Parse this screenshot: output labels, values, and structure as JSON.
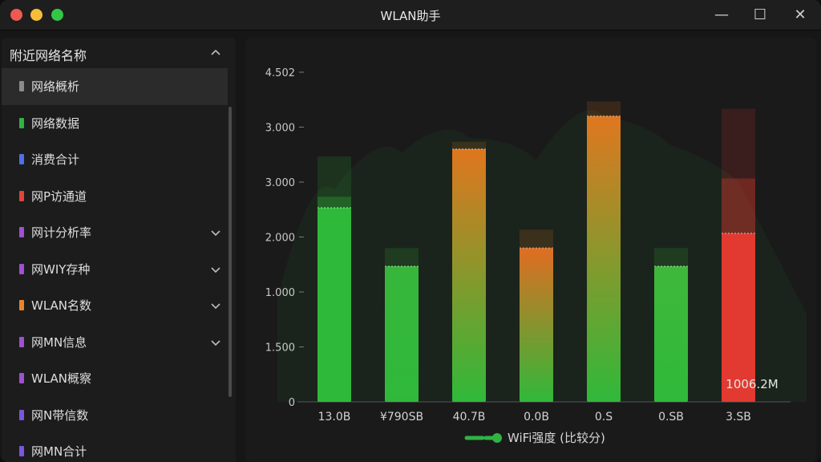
{
  "window": {
    "title": "WLAN助手",
    "controls": {
      "minimize": "—",
      "maximize": "☐",
      "close": "✕"
    }
  },
  "sidebar": {
    "header": "附近网络名称",
    "items": [
      {
        "label": "网络概析",
        "color": "#8a8a8a",
        "active": true,
        "expandable": false
      },
      {
        "label": "网络数据",
        "color": "#2fb344",
        "active": false,
        "expandable": false
      },
      {
        "label": "消费合计",
        "color": "#4f6ee8",
        "active": false,
        "expandable": false
      },
      {
        "label": "网P访通道",
        "color": "#e0443a",
        "active": false,
        "expandable": false
      },
      {
        "label": "网计分析率",
        "color": "#a050d0",
        "active": false,
        "expandable": true
      },
      {
        "label": "网WIY存种",
        "color": "#a050d0",
        "active": false,
        "expandable": true
      },
      {
        "label": "WLAN名数",
        "color": "#e8842e",
        "active": false,
        "expandable": true
      },
      {
        "label": "网MN信息",
        "color": "#a050d0",
        "active": false,
        "expandable": true
      },
      {
        "label": "WLAN概察",
        "color": "#a050d0",
        "active": false,
        "expandable": false
      },
      {
        "label": "网N带信数",
        "color": "#7a55e0",
        "active": false,
        "expandable": false
      },
      {
        "label": "网MN合计",
        "color": "#7a55e0",
        "active": false,
        "expandable": false
      }
    ]
  },
  "chart_data": {
    "type": "bar",
    "y_tick_labels": [
      "0",
      "1.500",
      "1.000",
      "2.000",
      "3.000",
      "3.000",
      "4.502"
    ],
    "categories": [
      "13.0B",
      "¥790SB",
      "40.7B",
      "0.0B",
      "0.S",
      "0.SB",
      "3.SB"
    ],
    "series": [
      {
        "name": "WiFi强度 (比较分)",
        "values": [
          2.65,
          1.85,
          3.45,
          2.1,
          3.9,
          1.85,
          2.3
        ],
        "ghost_values": [
          3.35,
          2.1,
          3.55,
          2.35,
          4.1,
          2.1,
          4.0
        ],
        "mid_values": [
          2.8,
          0,
          0,
          0,
          0,
          0,
          3.05
        ],
        "colors": [
          "#2fb93a",
          "#37b63a",
          "#e0761e",
          "#e06d22",
          "#e07720",
          "#3fb83a",
          "#e23a30"
        ],
        "gradient_bottom": [
          "#2fb93a",
          "#2fb93a",
          "#2fb93a",
          "#2fb93a",
          "#2fb93a",
          "#2fb93a",
          "#e23a30"
        ]
      }
    ],
    "ylim": [
      0,
      4.5
    ],
    "annotation": "1006.2M",
    "legend": {
      "label": "WiFi强度 (比较分)",
      "color": "#2fb344",
      "position": "bottom-center"
    },
    "grid": false
  }
}
